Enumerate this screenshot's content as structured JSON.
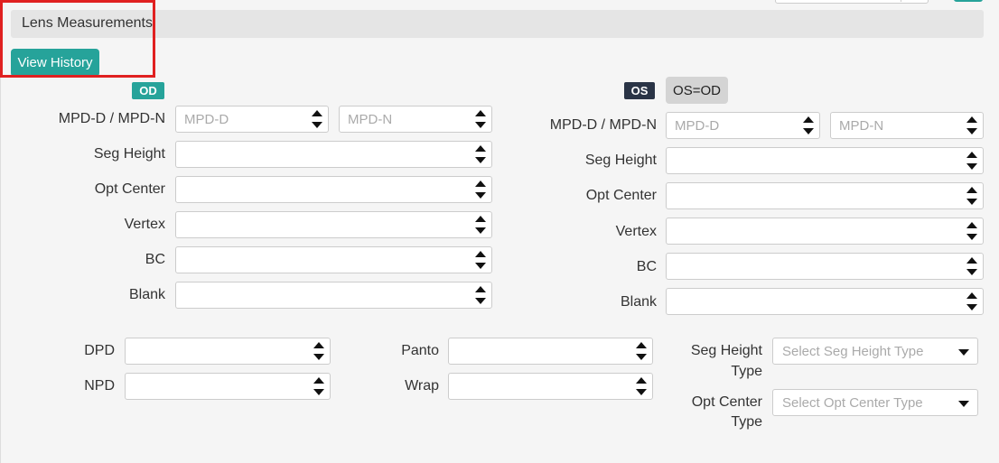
{
  "panel": {
    "title": "Lens Measurements",
    "history_button": "View History"
  },
  "od": {
    "badge": "OD",
    "labels": {
      "mpd": "MPD-D / MPD-N",
      "seg_height": "Seg Height",
      "opt_center": "Opt Center",
      "vertex": "Vertex",
      "bc": "BC",
      "blank": "Blank"
    },
    "placeholders": {
      "mpd_d": "MPD-D",
      "mpd_n": "MPD-N"
    },
    "values": {
      "mpd_d": "",
      "mpd_n": "",
      "seg_height": "",
      "opt_center": "",
      "vertex": "",
      "bc": "",
      "blank": ""
    }
  },
  "os": {
    "badge": "OS",
    "copy_button": "OS=OD",
    "labels": {
      "mpd": "MPD-D / MPD-N",
      "seg_height": "Seg Height",
      "opt_center": "Opt Center",
      "vertex": "Vertex",
      "bc": "BC",
      "blank": "Blank"
    },
    "placeholders": {
      "mpd_d": "MPD-D",
      "mpd_n": "MPD-N"
    },
    "values": {
      "mpd_d": "",
      "mpd_n": "",
      "seg_height": "",
      "opt_center": "",
      "vertex": "",
      "bc": "",
      "blank": ""
    }
  },
  "bottom": {
    "dpd_label": "DPD",
    "npd_label": "NPD",
    "panto_label": "Panto",
    "wrap_label": "Wrap",
    "seg_type_label_1": "Seg Height",
    "seg_type_label_2": "Type",
    "opt_type_label_1": "Opt Center",
    "opt_type_label_2": "Type",
    "seg_type_placeholder": "Select Seg Height Type",
    "opt_type_placeholder": "Select Opt Center Type",
    "values": {
      "dpd": "",
      "npd": "",
      "panto": "",
      "wrap": ""
    }
  },
  "colors": {
    "accent": "#26a39a",
    "os_badge": "#2a3446",
    "highlight": "#e02020",
    "header_bg": "#e5e5e5"
  }
}
